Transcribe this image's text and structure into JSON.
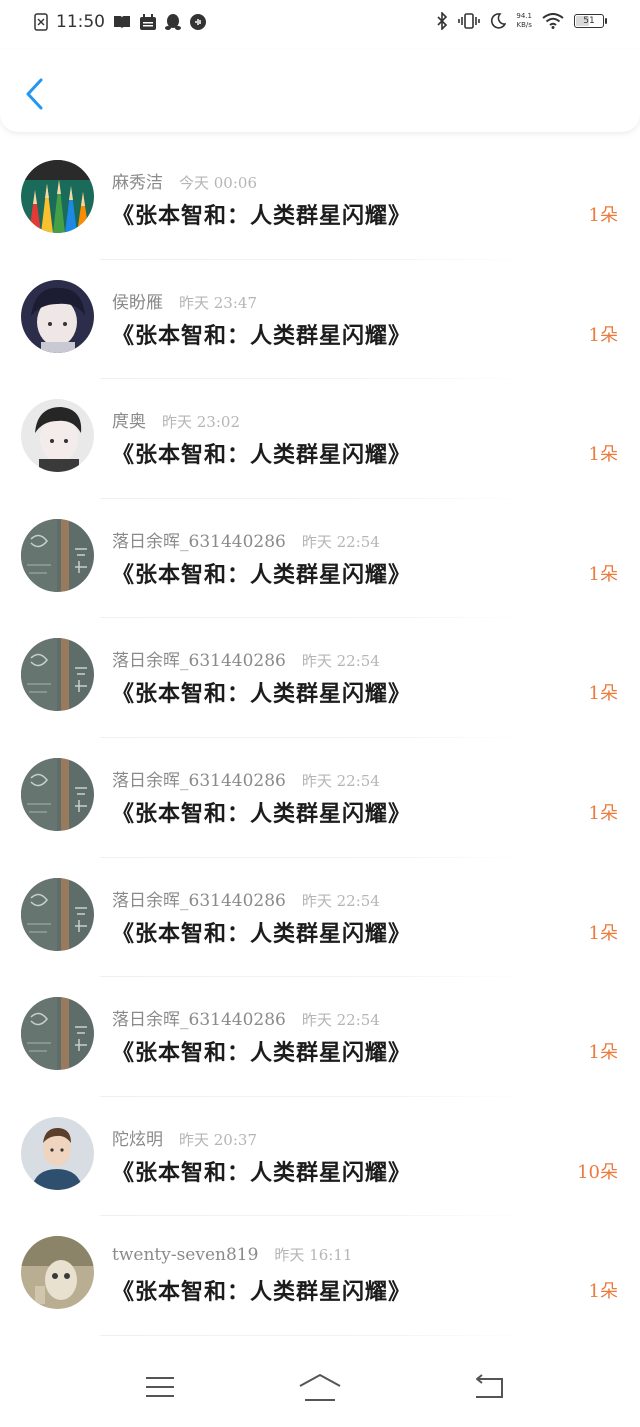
{
  "status_bar": {
    "time": "11:50",
    "net_speed_value": "94.1",
    "net_speed_unit": "KB/s",
    "battery": "51",
    "battery_level": 0.51,
    "icons": [
      "sim-off-icon",
      "book-icon",
      "calendar-icon",
      "qq-penguin-icon",
      "voice-app-icon",
      "bluetooth-icon",
      "vibrate-icon",
      "moon-icon",
      "wifi-icon",
      "battery-icon"
    ]
  },
  "header": {
    "back_icon": "chevron-left-icon",
    "accent_color": "#2196f3"
  },
  "colors": {
    "count": "#ec7a3b",
    "name": "#8a8a8a",
    "time": "#b5b5b5"
  },
  "items": [
    {
      "avatar": "pencils",
      "name": "麻秀洁",
      "time": "今天 00:06",
      "title": "《张本智和：人类群星闪耀》",
      "count": "1朵"
    },
    {
      "avatar": "boy-dark",
      "name": "侯盼雁",
      "time": "昨天 23:47",
      "title": "《张本智和：人类群星闪耀》",
      "count": "1朵"
    },
    {
      "avatar": "boy-light",
      "name": "庹奥",
      "time": "昨天 23:02",
      "title": "《张本智和：人类群星闪耀》",
      "count": "1朵"
    },
    {
      "avatar": "chalkboard",
      "name": "落日余晖_631440286",
      "time": "昨天 22:54",
      "title": "《张本智和：人类群星闪耀》",
      "count": "1朵"
    },
    {
      "avatar": "chalkboard",
      "name": "落日余晖_631440286",
      "time": "昨天 22:54",
      "title": "《张本智和：人类群星闪耀》",
      "count": "1朵"
    },
    {
      "avatar": "chalkboard",
      "name": "落日余晖_631440286",
      "time": "昨天 22:54",
      "title": "《张本智和：人类群星闪耀》",
      "count": "1朵"
    },
    {
      "avatar": "chalkboard",
      "name": "落日余晖_631440286",
      "time": "昨天 22:54",
      "title": "《张本智和：人类群星闪耀》",
      "count": "1朵"
    },
    {
      "avatar": "chalkboard",
      "name": "落日余晖_631440286",
      "time": "昨天 22:54",
      "title": "《张本智和：人类群星闪耀》",
      "count": "1朵"
    },
    {
      "avatar": "man-blue",
      "name": "陀炫明",
      "time": "昨天 20:37",
      "title": "《张本智和：人类群星闪耀》",
      "count": "10朵"
    },
    {
      "avatar": "beige-figure",
      "name": "twenty-seven819",
      "time": "昨天 16:11",
      "title": "《张本智和：人类群星闪耀》",
      "count": "1朵"
    }
  ],
  "bottom_nav": {
    "icons": [
      "menu-icon",
      "home-icon",
      "back-icon"
    ]
  }
}
